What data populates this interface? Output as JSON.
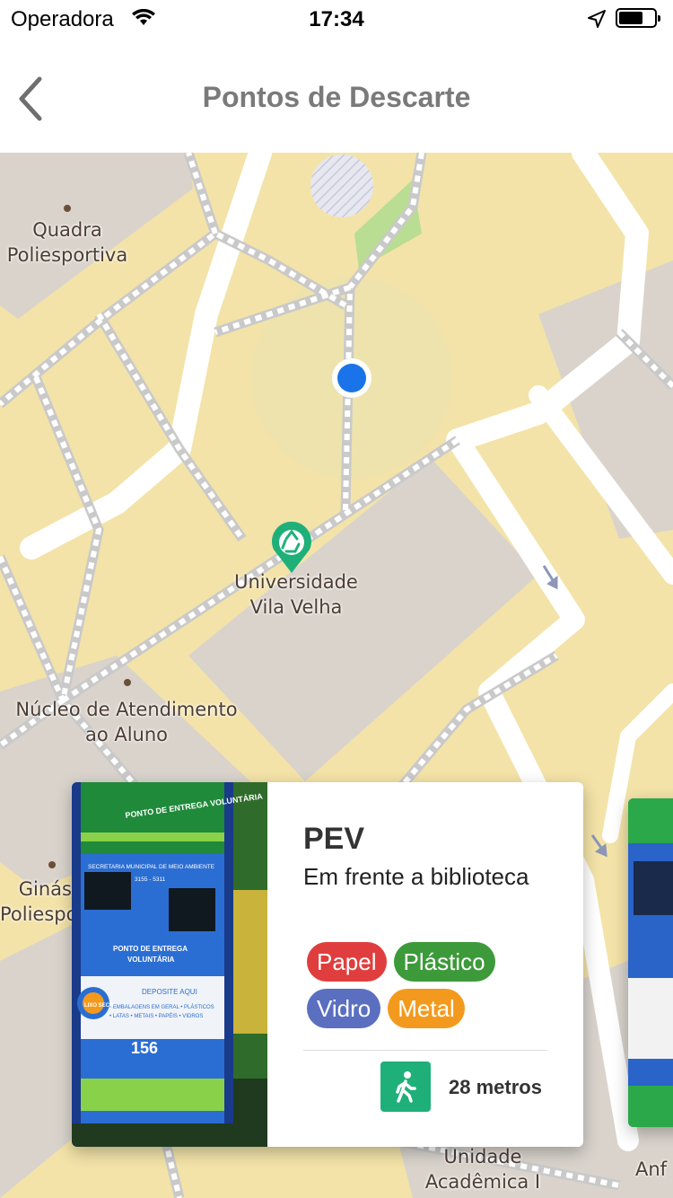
{
  "status_bar": {
    "carrier": "Operadora",
    "time": "17:34",
    "battery_level": 0.62
  },
  "nav": {
    "title": "Pontos de Descarte"
  },
  "map": {
    "labels": {
      "quadra": "Quadra\nPoliesportiva",
      "universidade": "Universidade\nVila Velha",
      "nucleo": "Núcleo de Atendimento\nao Aluno",
      "ginasio": "Ginás\nPoliespo",
      "unidade": "Unidade\nAcadêmica I",
      "anf": "Anf"
    }
  },
  "card": {
    "title": "PEV",
    "description": "Em frente a biblioteca",
    "tags": [
      {
        "label": "Papel",
        "color": "#e03e3e"
      },
      {
        "label": "Plástico",
        "color": "#3d9a3a"
      },
      {
        "label": "Vidro",
        "color": "#5a6fc0"
      },
      {
        "label": "Metal",
        "color": "#f39a1e"
      }
    ],
    "distance": "28 metros",
    "photo_texts": {
      "header": "PONTO DE ENTREGA VOLUNTÁRIA",
      "secretaria": "SECRETARIA MUNICIPAL DE MEIO AMBIENTE",
      "phone": "3155 - 5311",
      "ponto": "PONTO DE ENTREGA\nVOLUNTÁRIA",
      "deposite": "DEPOSITE AQUI",
      "itens": "• EMBALAGENS EM GERAL • PLÁSTICOS\n• LATAS • METAIS • PAPÉIS • VIDROS",
      "number": "156",
      "logo": "LIXO SECO"
    }
  },
  "colors": {
    "map_bg": "#f3e3a8",
    "building": "#d9d3cc",
    "road": "#ffffff",
    "user_dot": "#1a73e8",
    "marker": "#1fb07a",
    "walk_icon": "#1fb07a"
  }
}
